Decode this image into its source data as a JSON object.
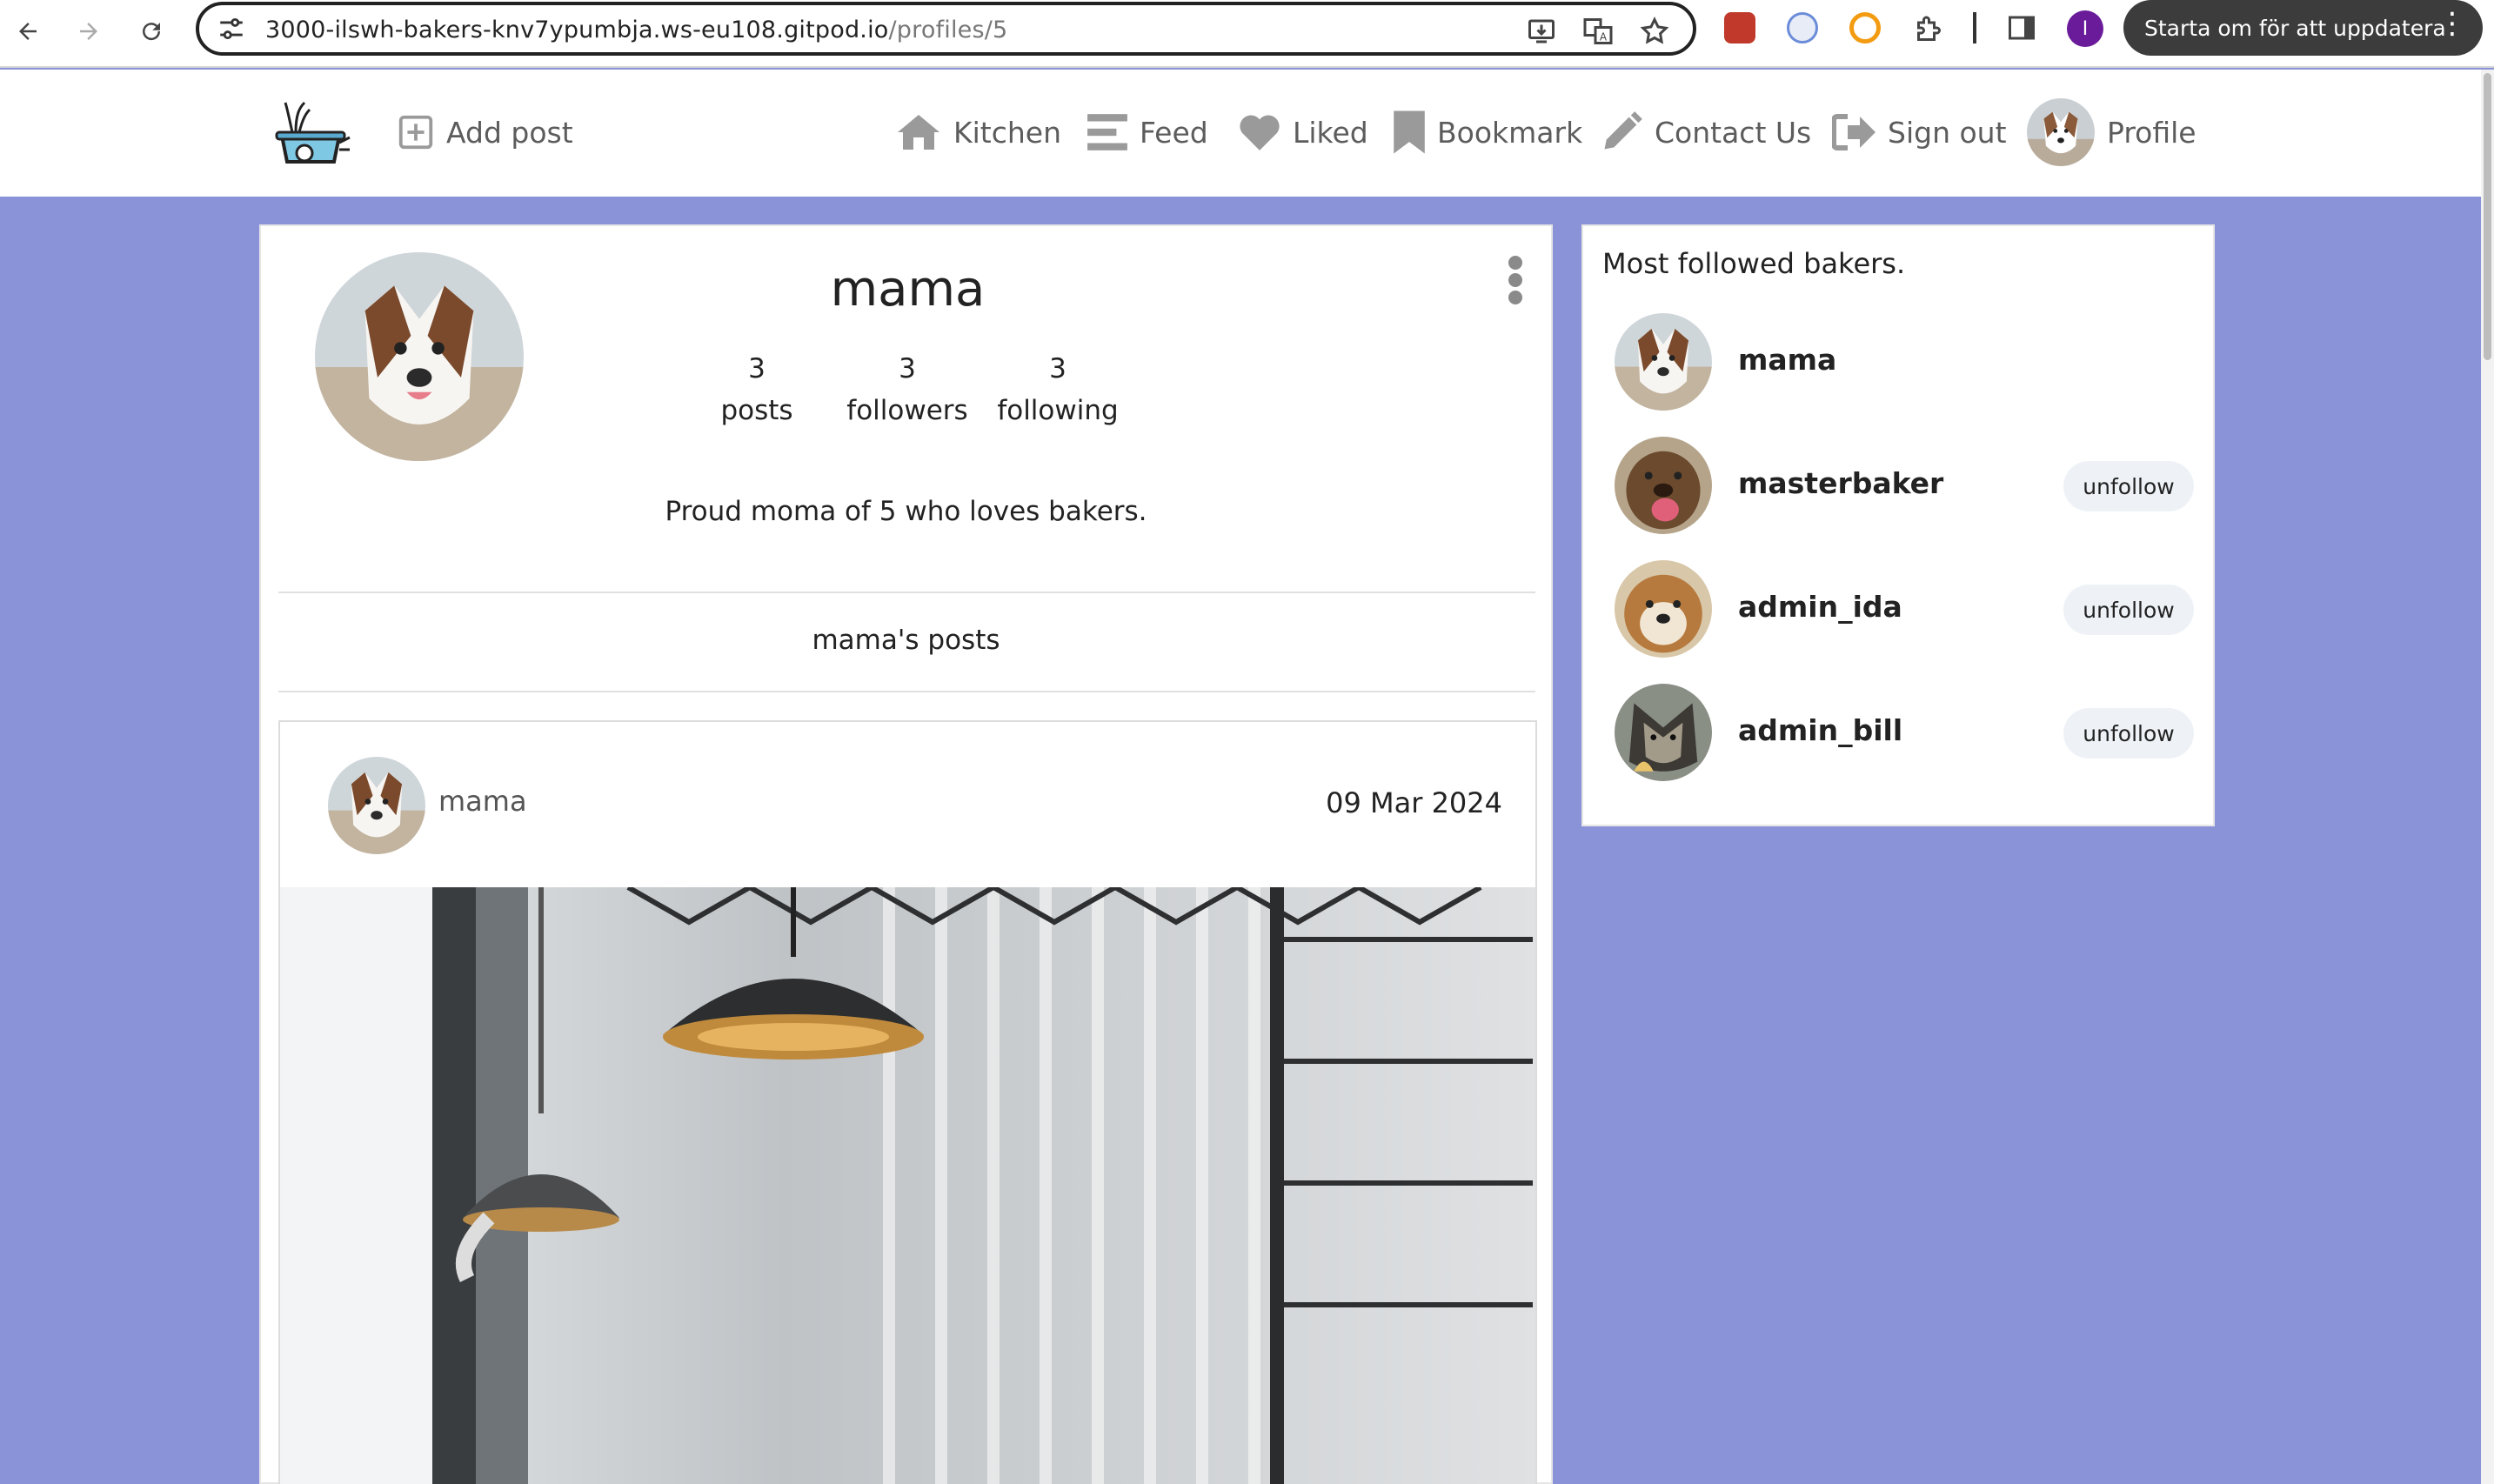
{
  "browser": {
    "url_host": "3000-ilswh-bakers-knv7ypumbja.ws-eu108.gitpod.io",
    "url_path": "/profiles/5",
    "profile_initial": "I",
    "update_label": "Starta om för att uppdatera"
  },
  "nav": {
    "add_post": "Add post",
    "kitchen": "Kitchen",
    "feed": "Feed",
    "liked": "Liked",
    "bookmark": "Bookmark",
    "contact": "Contact Us",
    "sign_out": "Sign out",
    "profile": "Profile"
  },
  "profile": {
    "username": "mama",
    "stats": [
      {
        "count": "3",
        "label": "posts"
      },
      {
        "count": "3",
        "label": "followers"
      },
      {
        "count": "3",
        "label": "following"
      }
    ],
    "bio": "Proud moma of 5 who loves bakers.",
    "posts_title": "mama's posts"
  },
  "post": {
    "author": "mama",
    "date": "09 Mar 2024"
  },
  "sidebar": {
    "title": "Most followed bakers.",
    "bakers": [
      {
        "name": "mama",
        "button": ""
      },
      {
        "name": "masterbaker",
        "button": "unfollow"
      },
      {
        "name": "admin_ida",
        "button": "unfollow"
      },
      {
        "name": "admin_bill",
        "button": "unfollow"
      }
    ]
  },
  "colors": {
    "page_bg": "#8b93d8",
    "card_bg": "#ffffff",
    "nav_icon": "#9a9a9a",
    "pill_bg": "#eef2f7"
  }
}
